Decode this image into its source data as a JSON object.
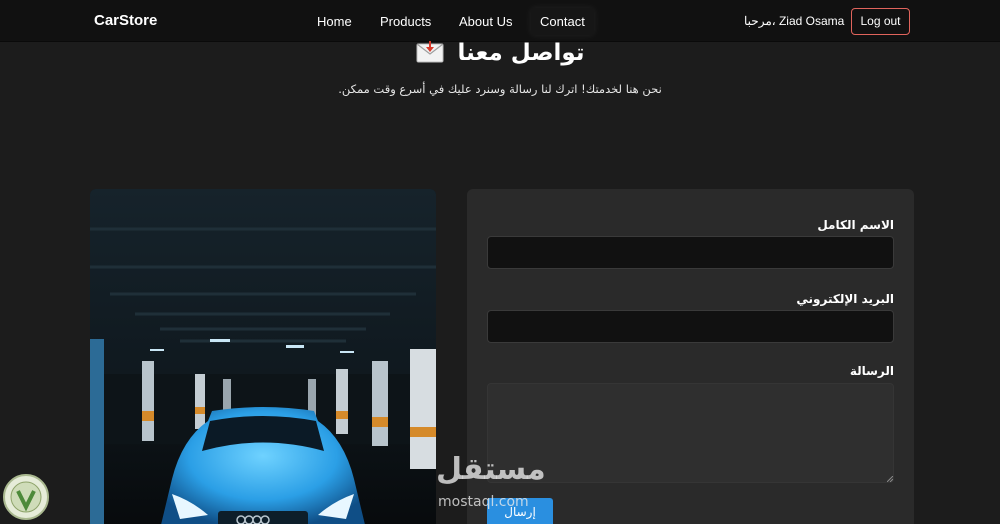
{
  "navbar": {
    "brand": "CarStore",
    "links": [
      {
        "label": "Home"
      },
      {
        "label": "Products"
      },
      {
        "label": "About Us"
      },
      {
        "label": "Contact",
        "active": true
      }
    ],
    "greeting": "مرحبا، Ziad Osama",
    "logout_label": "Log out"
  },
  "hero": {
    "title": "تواصل معنا",
    "title_icon": "envelope-icon",
    "subtitle": "نحن هنا لخدمتك! اترك لنا رسالة وسنرد عليك في أسرع وقت ممكن."
  },
  "contact_form": {
    "fields": [
      {
        "label": "الاسم الكامل",
        "value": ""
      },
      {
        "label": "البريد الإلكتروني",
        "value": ""
      },
      {
        "label": "الرسالة",
        "value": ""
      }
    ],
    "submit_label": "إرسال"
  },
  "image_panel": {
    "subject": "car-in-parking-garage"
  },
  "watermark": {
    "logo_text": "مستقل",
    "url": "mostaql.com"
  },
  "colors": {
    "background": "#1c1c1c",
    "navbar": "#111111",
    "card": "#2a2a2a",
    "input": "#111111",
    "accent_blue": "#2a8fe0",
    "logout_border": "#e0645c"
  }
}
